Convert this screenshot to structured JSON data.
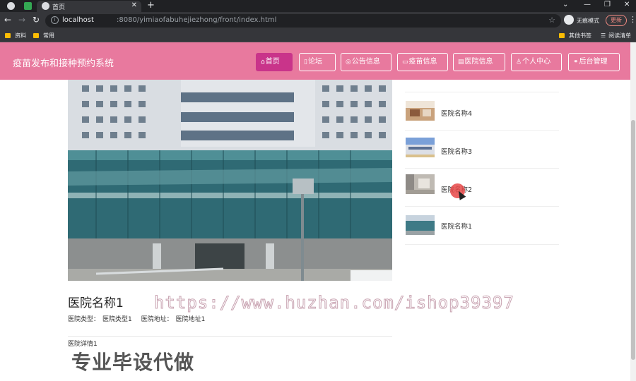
{
  "browser": {
    "tab_title": "首页",
    "url_host": "localhost",
    "url_path": ":8080/yimiaofabuhejiezhong/front/index.html",
    "incognito_label": "无痕模式",
    "update_label": "更新",
    "bookmarks": [
      "资料",
      "常用"
    ],
    "bookmarks_right": [
      "其他书签",
      "阅读清单"
    ]
  },
  "site": {
    "title": "疫苗发布和接种预约系统",
    "nav": [
      {
        "label": "首页",
        "icon": "home-icon",
        "active": true
      },
      {
        "label": "论坛",
        "icon": "forum-icon"
      },
      {
        "label": "公告信息",
        "icon": "notice-icon"
      },
      {
        "label": "疫苗信息",
        "icon": "vaccine-icon"
      },
      {
        "label": "医院信息",
        "icon": "hospital-icon"
      },
      {
        "label": "个人中心",
        "icon": "user-icon"
      },
      {
        "label": "后台管理",
        "icon": "link-icon"
      }
    ]
  },
  "detail": {
    "name": "医院名称1",
    "type_label": "医院类型：",
    "type_value": "医院类型1",
    "address_label": "医院地址：",
    "address_value": "医院地址1",
    "description": "医院详情1"
  },
  "side_list": [
    "医院名称4",
    "医院名称3",
    "医院名称2",
    "医院名称1"
  ],
  "overlay": {
    "watermark": "https://www.huzhan.com/ishop39397",
    "promo": "专业毕设代做"
  },
  "colors": {
    "header": "#e8799e",
    "nav_active": "#c9348a"
  }
}
